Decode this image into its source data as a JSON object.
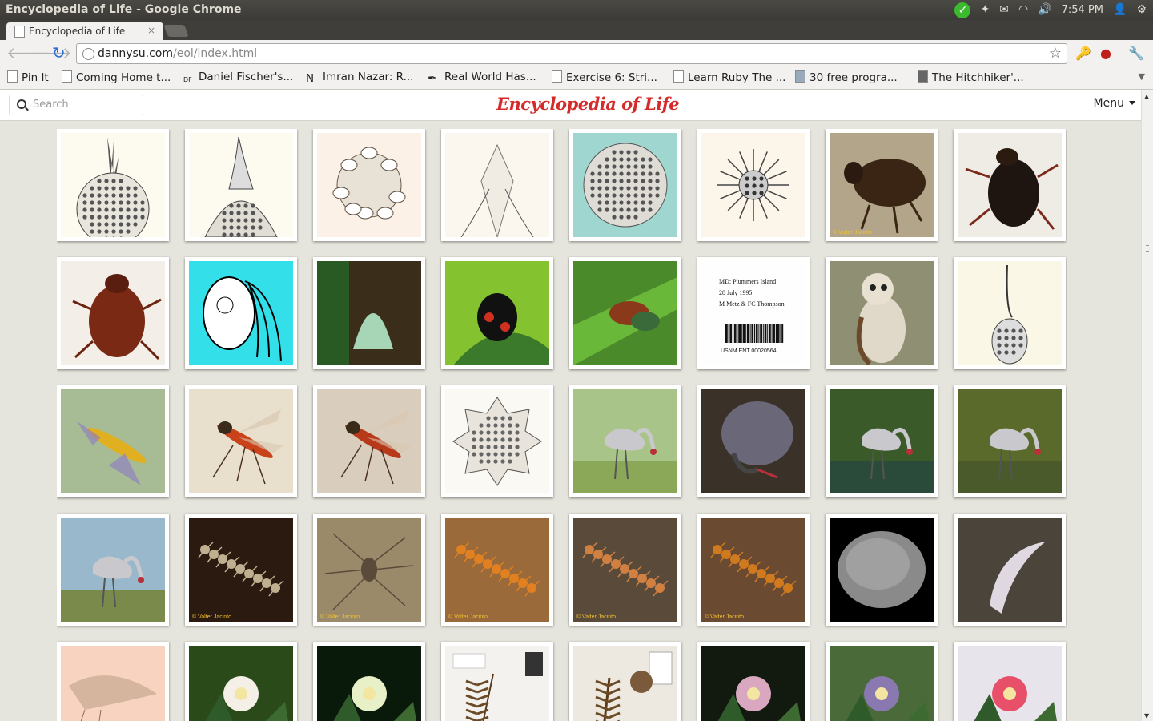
{
  "window": {
    "title": "Encyclopedia of Life - Google Chrome",
    "clock": "7:54 PM"
  },
  "tab": {
    "title": "Encyclopedia of Life",
    "close": "×"
  },
  "address_bar": {
    "host": "dannysu.com",
    "path": "/eol/index.html"
  },
  "bookmarks": [
    "Pin It",
    "Coming Home t...",
    "Daniel Fischer's...",
    "Imran Nazar: R...",
    "Real World Has...",
    "Exercise 6: Stri...",
    "Learn Ruby The ...",
    "30 free progra...",
    "The Hitchhiker'..."
  ],
  "site": {
    "logo": "Encyclopedia of Life",
    "search_placeholder": "Search",
    "menu_label": "Menu"
  },
  "gallery": {
    "label_text": "MD: Plummers Island\n28 July 1995\nM Metz & FC Thompson\nUSNM ENT 00020564",
    "watermark": "© Valter Jacinto",
    "rows": [
      [
        "radiolarian-spiked-sphere",
        "radiolarian-cone",
        "radiolarian-tubes",
        "radiolarian-spine",
        "radiolarian-teal",
        "radiolarian-star",
        "dung-beetle-ground",
        "dung-beetle-white"
      ],
      [
        "chafer-beetle",
        "protist-drawing",
        "green-planthopper",
        "shield-bug",
        "jewel-beetles",
        "specimen-label",
        "owl",
        "radiolarian-drop"
      ],
      [
        "hoverfly",
        "red-fly",
        "red-fly-hand",
        "radiolarian-spiky",
        "crane-trees",
        "heron-dark",
        "crane-water",
        "crane-pond"
      ],
      [
        "crane-grass",
        "millipede-dark",
        "spider-sand",
        "centipede-rock",
        "centipede-soil",
        "centipede-leaves",
        "pollen-grain",
        "feather-larva"
      ],
      [
        "shrimp-larva",
        "orchid-spotted",
        "orchid-green",
        "fern-specimen",
        "seed-specimen",
        "pink-flower",
        "purple-flowers",
        "red-flowers"
      ]
    ]
  }
}
